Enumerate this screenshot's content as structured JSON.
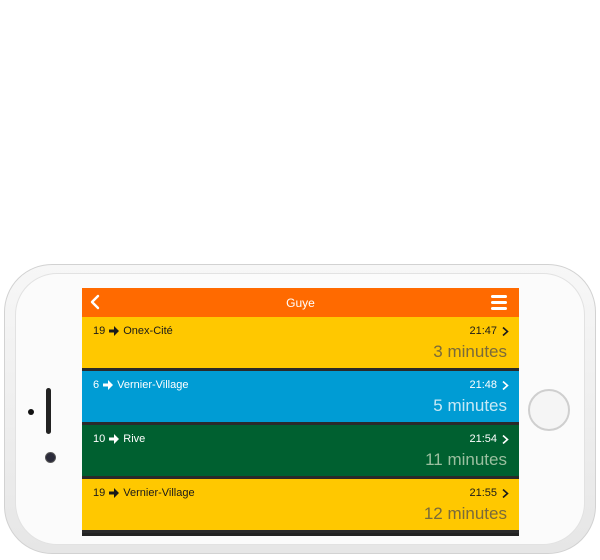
{
  "nav": {
    "title": "Guye"
  },
  "departures": [
    {
      "line": "19",
      "destination": "Onex-Cité",
      "time": "21:47",
      "eta": "3 minutes",
      "color": "#ffc800"
    },
    {
      "line": "6",
      "destination": "Vernier-Village",
      "time": "21:48",
      "eta": "5 minutes",
      "color": "#009cd4"
    },
    {
      "line": "10",
      "destination": "Rive",
      "time": "21:54",
      "eta": "11 minutes",
      "color": "#006030"
    },
    {
      "line": "19",
      "destination": "Vernier-Village",
      "time": "21:55",
      "eta": "12 minutes",
      "color": "#ffc800"
    }
  ],
  "colors": {
    "navbar": "#ff6a00"
  },
  "icons": {
    "back": "back-chevron-icon",
    "menu": "menu-icon",
    "arrow": "arrow-right-icon",
    "row_chevron": "chevron-right-icon"
  }
}
